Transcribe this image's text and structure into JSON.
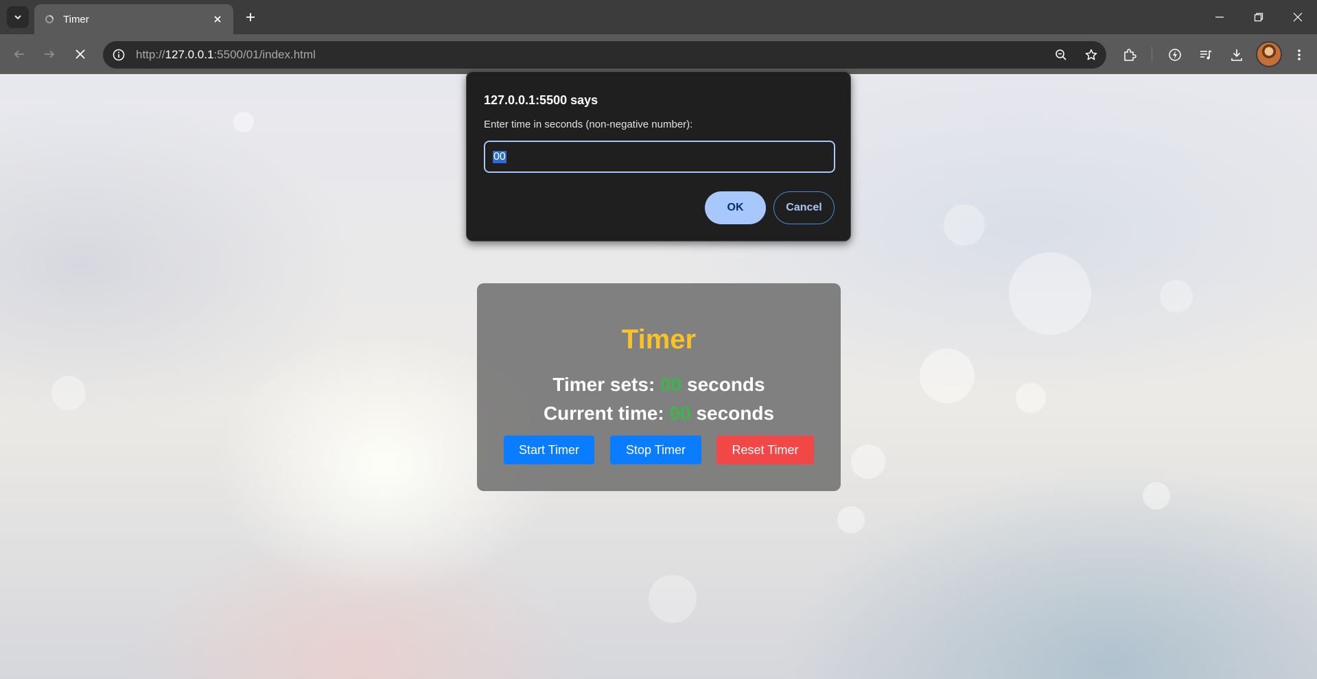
{
  "browser": {
    "tab": {
      "title": "Timer"
    },
    "address": {
      "host": "127.0.0.1",
      "rest": ":5500/01/index.html",
      "scheme": "http://"
    }
  },
  "page": {
    "title": "Timer",
    "timer_sets": {
      "label": "Timer sets:",
      "value": "00",
      "unit": "seconds"
    },
    "current_time": {
      "label": "Current time:",
      "value": "00",
      "unit": "seconds"
    },
    "buttons": {
      "start": "Start Timer",
      "stop": "Stop Timer",
      "reset": "Reset Timer"
    },
    "colors": {
      "title": "#f7c325",
      "number": "#3cb648",
      "primary": "#0a7cff",
      "danger": "#f24747"
    }
  },
  "dialog": {
    "title": "127.0.0.1:5500 says",
    "message": "Enter time in seconds (non-negative number):",
    "input_value": "00",
    "ok_label": "OK",
    "cancel_label": "Cancel"
  }
}
